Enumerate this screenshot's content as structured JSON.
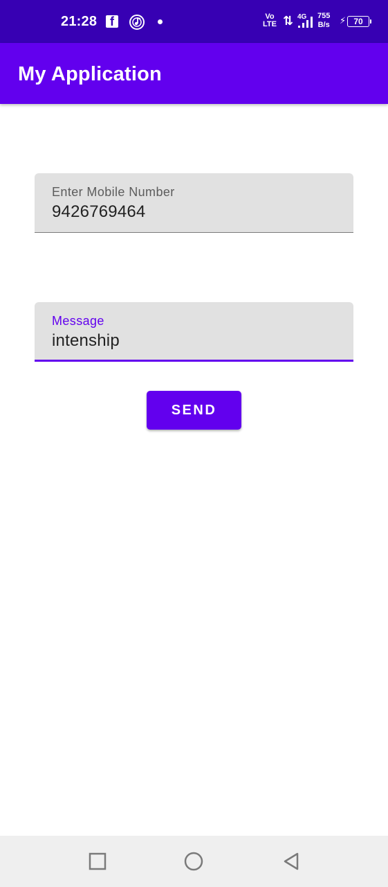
{
  "status_bar": {
    "time": "21:28",
    "facebook_icon": "facebook-icon",
    "music_icon": "music-icon",
    "volte_top": "Vo",
    "volte_bottom": "LTE",
    "network_type": "4G",
    "speed_value": "755",
    "speed_unit": "B/s",
    "battery_level": "70"
  },
  "app_bar": {
    "title": "My Application",
    "background_color": "#6200ee"
  },
  "form": {
    "mobile": {
      "hint": "Enter Mobile Number",
      "value": "9426769464"
    },
    "message": {
      "hint": "Message",
      "value": "intenship"
    },
    "send_label": "SEND"
  },
  "nav_bar": {
    "recents_icon": "square-icon",
    "home_icon": "circle-icon",
    "back_icon": "triangle-back-icon"
  },
  "colors": {
    "status_bar": "#3700b3",
    "primary": "#6200ee",
    "field_background": "#e1e1e1"
  }
}
